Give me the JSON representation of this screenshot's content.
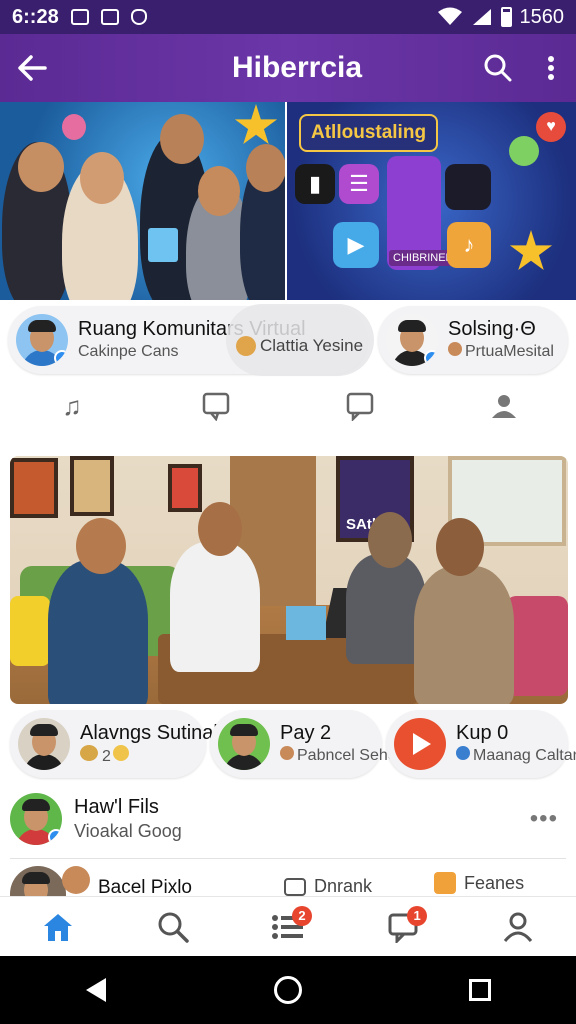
{
  "status_bar": {
    "time": "6::28",
    "battery_text": "1560",
    "icons": [
      "notification-a-icon",
      "image-icon",
      "shield-icon",
      "wifi-icon",
      "signal-icon",
      "battery-icon"
    ]
  },
  "app_bar": {
    "title": "Hiberrcia",
    "back_icon": "arrow-left-icon",
    "search_icon": "search-icon",
    "menu_icon": "more-vertical-icon",
    "color": "#6b36a8"
  },
  "hero": {
    "right_badge": "Atlloustaling",
    "right_tile_label": "CHIBRINERO"
  },
  "chips_row1": [
    {
      "name": "Ruang Komunitars Virtual",
      "sub": "Cakinpe Cans"
    },
    {
      "name": "",
      "sub": "Clattia Yesine"
    },
    {
      "name": "Solsing·Θ",
      "sub": "PrtuaMesital"
    }
  ],
  "action_icons": [
    "music-notes-icon",
    "comment-icon",
    "chat-bubble-icon",
    "profile-icon"
  ],
  "chips_row2": [
    {
      "name": "Alavngs Sutinal",
      "sub": "2"
    },
    {
      "name": "Pay 2",
      "sub": "Pabncel Sehen"
    },
    {
      "name": "Kup 0",
      "sub": "Maanag Caltan"
    }
  ],
  "photo": {
    "poster_text": "SAtb"
  },
  "list": [
    {
      "name": "Haw'l Fils",
      "sub": "Vioakal Goog",
      "more": "•••"
    },
    {
      "name": "Bacel Pixlo",
      "mid": "Dnrank",
      "right": "Feanes"
    }
  ],
  "bottom_nav": [
    {
      "icon": "home-icon",
      "active": true
    },
    {
      "icon": "search-icon",
      "active": false
    },
    {
      "icon": "list-icon",
      "badge": "2"
    },
    {
      "icon": "chat-icon",
      "badge": "1"
    },
    {
      "icon": "profile-icon",
      "active": false
    }
  ],
  "colors": {
    "accent": "#6b36a8",
    "active_nav": "#2a86e0",
    "badge": "#e8452f"
  }
}
